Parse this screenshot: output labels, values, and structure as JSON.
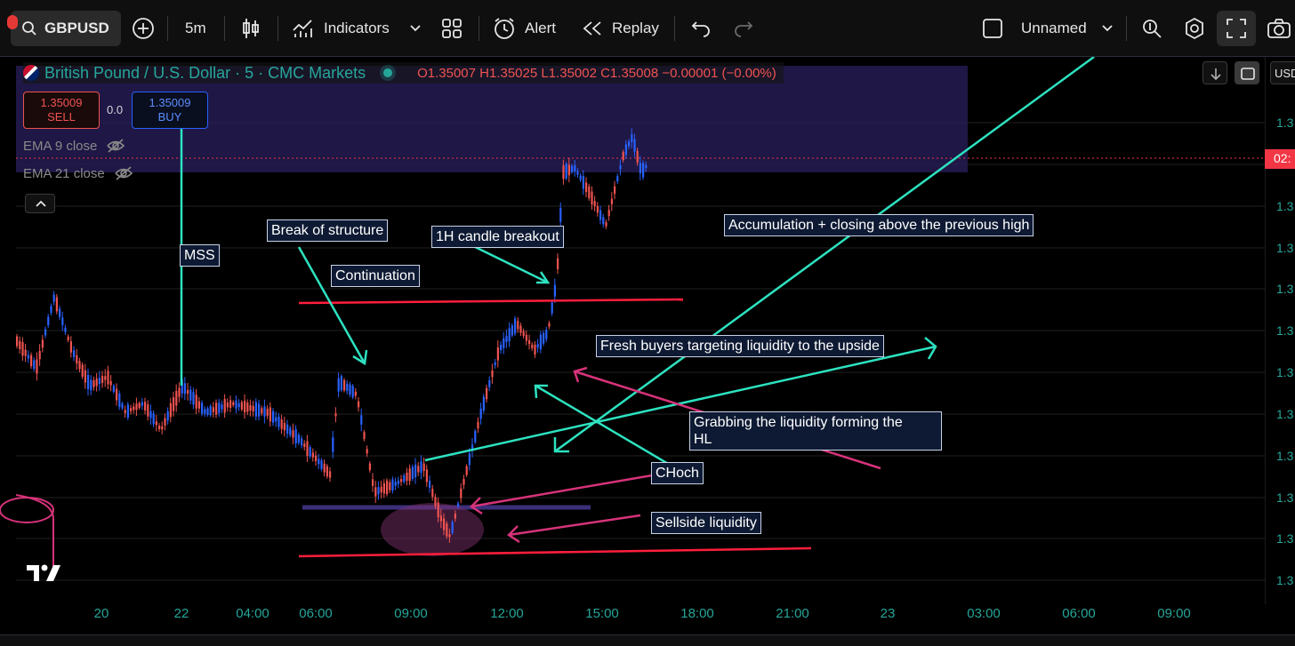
{
  "toolbar": {
    "symbol": "GBPUSD",
    "interval": "5m",
    "indicators_label": "Indicators",
    "alert_label": "Alert",
    "replay_label": "Replay",
    "layout_name": "Unnamed"
  },
  "legend": {
    "title": "British Pound / U.S. Dollar · 5 · CMC Markets",
    "ohlc": "O1.35007  H1.35025  L1.35002  C1.35008  −0.00001 (−0.00%)"
  },
  "trade": {
    "sell_price": "1.35009",
    "sell_label": "SELL",
    "spread": "0.0",
    "buy_price": "1.35009",
    "buy_label": "BUY"
  },
  "indicators": [
    {
      "label": "EMA 9 close"
    },
    {
      "label": "EMA 21 close"
    }
  ],
  "annotations": {
    "mss": "MSS",
    "bos": "Break of structure",
    "continuation": "Continuation",
    "h1_breakout": "1H candle breakout",
    "accumulation": "Accumulation + closing above the previous high",
    "fresh_buyers": "Fresh buyers targeting liquidity to the upside",
    "grabbing_line1": "Grabbing the liquidity forming the",
    "grabbing_line2": "HL",
    "choch": "CHoch",
    "sellside": "Sellside liquidity"
  },
  "price_scale": {
    "currency": "USD",
    "tick_label": "1.3",
    "current_label": "02:"
  },
  "time_axis": [
    "20",
    "22",
    "04:00",
    "06:00",
    "09:00",
    "12:00",
    "15:00",
    "18:00",
    "21:00",
    "23",
    "03:00",
    "06:00",
    "09:00"
  ],
  "colors": {
    "up": "#2962ff",
    "down": "#ef5350",
    "annotation_cyan": "#2de2c0",
    "annotation_pink": "#d6337a",
    "level_red": "#ff1e3c",
    "zone": "#2a1f5c"
  }
}
